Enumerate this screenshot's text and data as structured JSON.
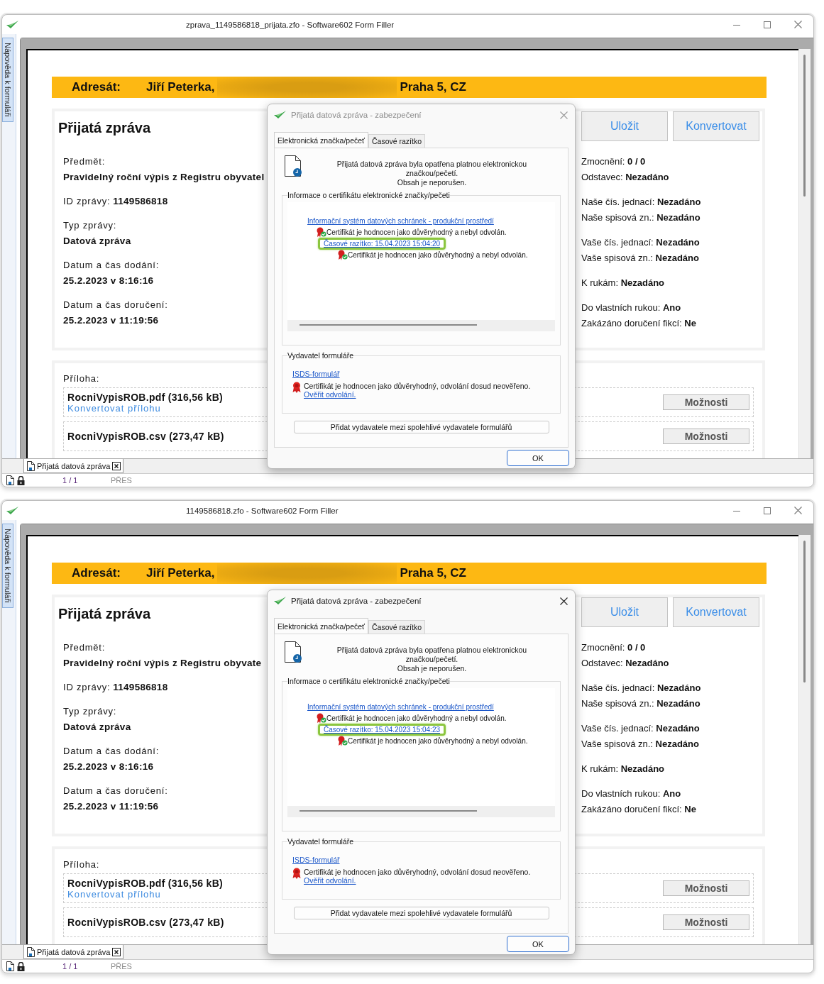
{
  "windows": [
    {
      "title": "zprava_1149586818_prijata.zfo - Software602 Form Filler",
      "sidebar_tab": "Nápověda k formuláři",
      "addressee": {
        "label": "Adresát:",
        "name": "Jiří Peterka,",
        "city": "Praha 5, CZ"
      },
      "message": {
        "heading": "Přijatá zpráva",
        "buttons": [
          "Uložit",
          "Konvertovat"
        ],
        "fields": [
          {
            "kind": "stacked",
            "label": "Předmět:",
            "value": "Pravidelný roční výpis z Registru obyvatel"
          },
          {
            "kind": "inline",
            "label": "ID zprávy:",
            "value": "1149586818"
          },
          {
            "kind": "stacked",
            "label": "Typ zprávy:",
            "value": "Datová zpráva"
          },
          {
            "kind": "stacked",
            "label": "Datum a čas dodání:",
            "value": "25.2.2023 v 8:16:16"
          },
          {
            "kind": "stacked",
            "label": "Datum a čas doručení:",
            "value": "25.2.2023 v 11:19:56"
          }
        ],
        "details": [
          [
            {
              "label": "Zmocnění:",
              "value": "0 / 0"
            },
            {
              "label": "Odstavec:",
              "value": "Nezadáno"
            }
          ],
          [
            {
              "label": "Naše čís. jednací:",
              "value": "Nezadáno"
            },
            {
              "label": "Naše spisová zn.:",
              "value": "Nezadáno"
            }
          ],
          [
            {
              "label": "Vaše čís. jednací:",
              "value": "Nezadáno"
            },
            {
              "label": "Vaše spisová zn.:",
              "value": "Nezadáno"
            }
          ],
          [
            {
              "label": "K rukám:",
              "value": "Nezadáno"
            }
          ],
          [
            {
              "label": "Do vlastních rukou:",
              "value": "Ano"
            },
            {
              "label": "Zakázáno doručení fikcí:",
              "value": "Ne"
            }
          ]
        ]
      },
      "attachments": {
        "label": "Příloha:",
        "files": [
          {
            "name": "RocniVypisROB.pdf (316,56 kB)",
            "link": "Konvertovat přílohu",
            "button": "Možnosti"
          },
          {
            "name": "RocniVypisROB.csv (273,47 kB)",
            "button": "Možnosti"
          }
        ]
      },
      "doc_tab": "Přijatá datová zpráva",
      "status": {
        "page": "1 / 1",
        "mode": "PŘES"
      },
      "dialog": {
        "active": false,
        "title": "Přijatá datová zpráva - zabezpečení",
        "tabs": [
          {
            "label": "Elektronická značka/pečeť",
            "selected": true
          },
          {
            "label": "Časové razítko",
            "selected": false
          }
        ],
        "message": [
          "Přijatá datová zpráva byla opatřena platnou elektronickou",
          "značkou/pečetí.",
          "Obsah je neporušen."
        ],
        "cert_group": {
          "legend": "Informace o certifikátu elektronické značky/pečeti",
          "issuer": "Informační systém datových schránek - produkční prostředí",
          "cert_status": "Certifikát je hodnocen jako důvěryhodný a nebyl odvolán.",
          "timestamp": {
            "text": "Časové razítko: 15.04.2023 15:04:20",
            "highlighted": true
          },
          "timestamp_status": "Certifikát je hodnocen jako důvěryhodný a nebyl odvolán."
        },
        "publisher_group": {
          "legend": "Vydavatel formuláře",
          "link": "ISDS-formulář",
          "status": "Certifikát je hodnocen jako důvěryhodný, odvolání dosud neověřeno.",
          "verify_link": "Ověřit odvolání."
        },
        "trust_button": "Přidat vydavatele mezi spolehlivé vydavatele formulářů",
        "ok_button": "OK"
      }
    },
    {
      "title": "1149586818.zfo - Software602 Form Filler",
      "sidebar_tab": "Nápověda k formuláři",
      "addressee": {
        "label": "Adresát:",
        "name": "Jiří Peterka,",
        "city": "Praha 5, CZ"
      },
      "message": {
        "heading": "Přijatá zpráva",
        "buttons": [
          "Uložit",
          "Konvertovat"
        ],
        "fields": [
          {
            "kind": "stacked",
            "label": "Předmět:",
            "value": "Pravidelný roční výpis z Registru obyvate"
          },
          {
            "kind": "inline",
            "label": "ID zprávy:",
            "value": "1149586818"
          },
          {
            "kind": "stacked",
            "label": "Typ zprávy:",
            "value": "Datová zpráva"
          },
          {
            "kind": "stacked",
            "label": "Datum a čas dodání:",
            "value": "25.2.2023 v 8:16:16"
          },
          {
            "kind": "stacked",
            "label": "Datum a čas doručení:",
            "value": "25.2.2023 v 11:19:56"
          }
        ],
        "details": [
          [
            {
              "label": "Zmocnění:",
              "value": "0 / 0"
            },
            {
              "label": "Odstavec:",
              "value": "Nezadáno"
            }
          ],
          [
            {
              "label": "Naše čís. jednací:",
              "value": "Nezadáno"
            },
            {
              "label": "Naše spisová zn.:",
              "value": "Nezadáno"
            }
          ],
          [
            {
              "label": "Vaše čís. jednací:",
              "value": "Nezadáno"
            },
            {
              "label": "Vaše spisová zn.:",
              "value": "Nezadáno"
            }
          ],
          [
            {
              "label": "K rukám:",
              "value": "Nezadáno"
            }
          ],
          [
            {
              "label": "Do vlastních rukou:",
              "value": "Ano"
            },
            {
              "label": "Zakázáno doručení fikcí:",
              "value": "Ne"
            }
          ]
        ]
      },
      "attachments": {
        "label": "Příloha:",
        "files": [
          {
            "name": "RocniVypisROB.pdf (316,56 kB)",
            "link": "Konvertovat přílohu",
            "button": "Možnosti"
          },
          {
            "name": "RocniVypisROB.csv (273,47 kB)",
            "button": "Možnosti"
          }
        ]
      },
      "doc_tab": "Přijatá datová zpráva",
      "status": {
        "page": "1 / 1",
        "mode": "PŘES"
      },
      "dialog": {
        "active": true,
        "title": "Přijatá datová zpráva - zabezpečení",
        "tabs": [
          {
            "label": "Elektronická značka/pečeť",
            "selected": true
          },
          {
            "label": "Časové razítko",
            "selected": false
          }
        ],
        "message": [
          "Přijatá datová zpráva byla opatřena platnou elektronickou",
          "značkou/pečetí.",
          "Obsah je neporušen."
        ],
        "cert_group": {
          "legend": "Informace o certifikátu elektronické značky/pečeti",
          "issuer": "Informační systém datových schránek - produkční prostředí",
          "cert_status": "Certifikát je hodnocen jako důvěryhodný a nebyl odvolán.",
          "timestamp": {
            "text": "Časové razítko: 15.04.2023 15:04:23",
            "highlighted": true
          },
          "timestamp_status": "Certifikát je hodnocen jako důvěryhodný a nebyl odvolán."
        },
        "publisher_group": {
          "legend": "Vydavatel formuláře",
          "link": "ISDS-formulář",
          "status": "Certifikát je hodnocen jako důvěryhodný, odvolání dosud neověřeno.",
          "verify_link": "Ověřit odvolání."
        },
        "trust_button": "Přidat vydavatele mezi spolehlivé vydavatele formulářů",
        "ok_button": "OK"
      }
    }
  ]
}
